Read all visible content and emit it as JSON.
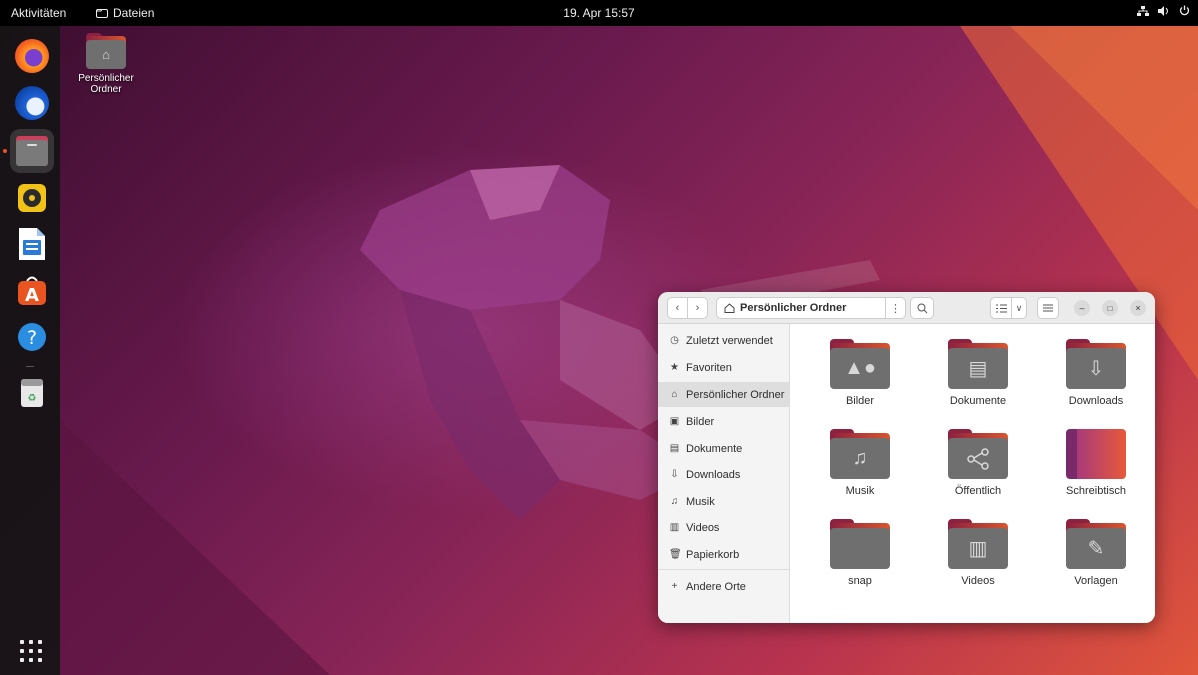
{
  "topbar": {
    "activities": "Aktivitäten",
    "app_menu": "Dateien",
    "clock": "19. Apr 15:57"
  },
  "dock": {
    "apps": [
      {
        "name": "Firefox",
        "icon": "firefox-icon"
      },
      {
        "name": "Thunderbird",
        "icon": "thunderbird-icon"
      },
      {
        "name": "Dateien",
        "icon": "files-icon",
        "active": true
      },
      {
        "name": "Rhythmbox",
        "icon": "rhythmbox-icon"
      },
      {
        "name": "LibreOffice Writer",
        "icon": "writer-icon"
      },
      {
        "name": "Ubuntu Software",
        "icon": "software-icon"
      },
      {
        "name": "Hilfe",
        "icon": "help-icon"
      },
      {
        "name": "Papierkorb",
        "icon": "trash-icon"
      }
    ]
  },
  "desktop": {
    "home_label_line1": "Persönlicher",
    "home_label_line2": "Ordner"
  },
  "file_manager": {
    "location": "Persönlicher Ordner",
    "sidebar": [
      {
        "label": "Zuletzt verwendet",
        "icon": "clock-icon"
      },
      {
        "label": "Favoriten",
        "icon": "star-icon"
      },
      {
        "label": "Persönlicher Ordner",
        "icon": "home-icon",
        "selected": true
      },
      {
        "label": "Bilder",
        "icon": "image-icon"
      },
      {
        "label": "Dokumente",
        "icon": "document-icon"
      },
      {
        "label": "Downloads",
        "icon": "download-icon"
      },
      {
        "label": "Musik",
        "icon": "music-icon"
      },
      {
        "label": "Videos",
        "icon": "video-icon"
      },
      {
        "label": "Papierkorb",
        "icon": "trash-icon"
      }
    ],
    "other_places": "Andere Orte",
    "folders": [
      {
        "label": "Bilder",
        "icon": "image-icon"
      },
      {
        "label": "Dokumente",
        "icon": "document-icon"
      },
      {
        "label": "Downloads",
        "icon": "download-icon"
      },
      {
        "label": "Musik",
        "icon": "music-icon"
      },
      {
        "label": "Öffentlich",
        "icon": "share-icon"
      },
      {
        "label": "Schreibtisch",
        "icon": "desktop-icon"
      },
      {
        "label": "snap",
        "icon": "folder-icon"
      },
      {
        "label": "Videos",
        "icon": "video-icon"
      },
      {
        "label": "Vorlagen",
        "icon": "template-icon"
      }
    ]
  },
  "colors": {
    "accent": "#e95420",
    "folder_tab": "#8c2140",
    "folder_body": "#6f6f6f"
  }
}
